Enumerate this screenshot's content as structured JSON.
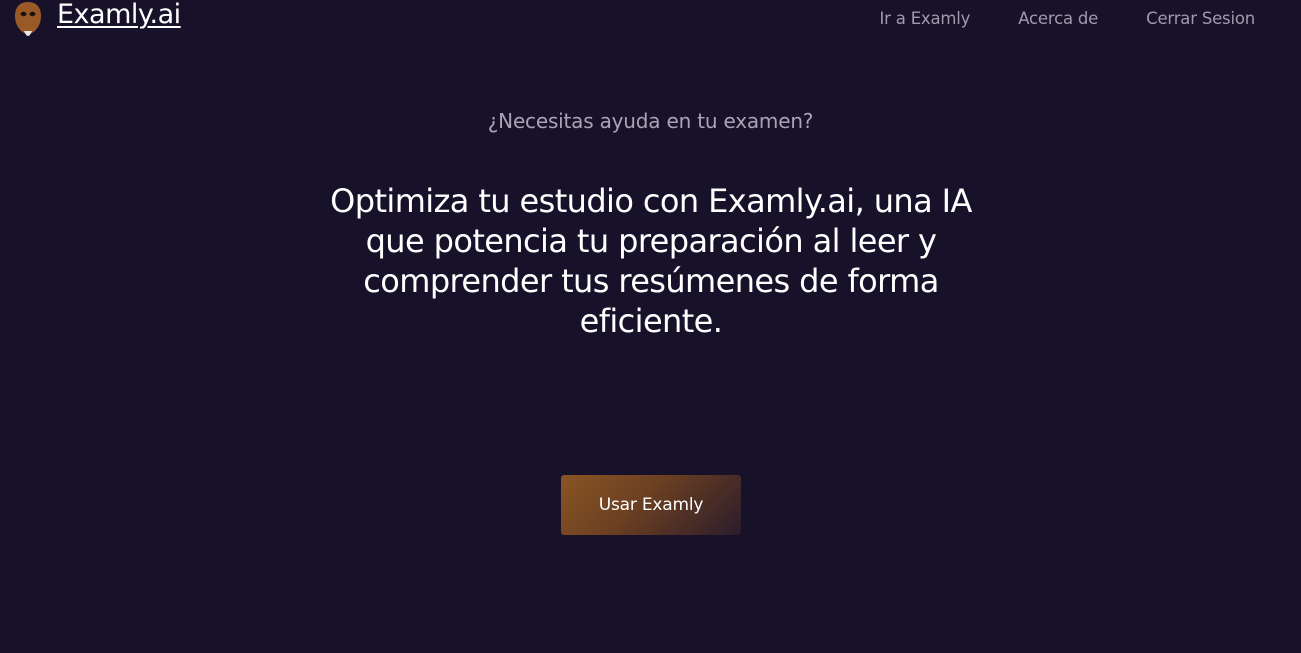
{
  "header": {
    "brand_name": "Examly.ai",
    "brand_icon": "owl-mascot-icon",
    "nav": [
      {
        "label": "Ir a Examly"
      },
      {
        "label": "Acerca de"
      },
      {
        "label": "Cerrar Sesion"
      }
    ]
  },
  "hero": {
    "kicker": "¿Necesitas ayuda en tu examen?",
    "headline": "Optimiza tu estudio con Examly.ai, una IA que potencia tu preparación al leer y comprender tus resúmenes de forma eficiente.",
    "cta_label": "Usar Examly"
  },
  "colors": {
    "background": "#18112a",
    "muted_text": "#a09aab",
    "accent": "#8a5524",
    "mascot": "#9a5a27"
  }
}
